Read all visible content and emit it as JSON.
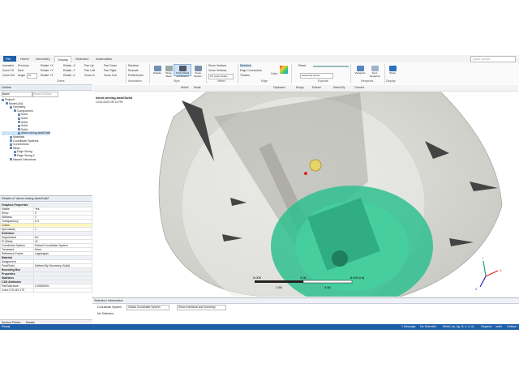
{
  "tabs": [
    "File",
    "Home",
    "Geometry",
    "Display",
    "Selection",
    "Automation"
  ],
  "active_tab": "Display",
  "search_placeholder": "Quick Launch",
  "ribbon": {
    "orient_items": [
      "Isometric",
      "Previous",
      "Rotate +X",
      "Rotate -X",
      "Pan Up",
      "Pan Down",
      "Random"
    ],
    "orient_items2": [
      "Zoom Fit",
      "Next",
      "Rotate +Y",
      "Rotate -Y",
      "Pan Left",
      "Pan Right",
      "Rescale"
    ],
    "orient_items3": [
      "Zoom Sel",
      "Angle",
      "Rotate +Z",
      "Rotate -Z",
      "Zoom In",
      "Zoom Out",
      "Preferences"
    ],
    "angle_value": "10",
    "group_orient": "Orient",
    "group_annotation": "Annotation",
    "style_buttons": [
      "Display",
      "Show Mesh",
      "Thick Shells and Beams",
      "Cross Section"
    ],
    "group_style": "Style",
    "vertex_items": [
      "Show Vertices",
      "Close Vertices",
      "Wireframe"
    ],
    "vertex_dd": "0.5 (Auto Scale)",
    "group_vertex": "Vertex",
    "edge_items": [
      "Direction",
      "Edge Connection",
      "Thicken"
    ],
    "group_edge": "Edge",
    "color_label": "Color",
    "explode_label": "Reset",
    "explode_dd": "Assembly Center",
    "group_explode": "Explode",
    "viewports_label": "Viewports",
    "sync_label": "Sync Viewports",
    "group_viewports": "Viewports",
    "display_label": "Show",
    "group_display": "Display"
  },
  "outline": {
    "title": "Outline",
    "name_label": "Name",
    "search_placeholder": "Search Outline",
    "items": [
      {
        "label": "Project*",
        "indent": 0
      },
      {
        "label": "Model (A4)",
        "indent": 1
      },
      {
        "label": "Geometry",
        "indent": 2
      },
      {
        "label": "Component1",
        "indent": 3
      },
      {
        "label": "Solid",
        "indent": 4
      },
      {
        "label": "Solid",
        "indent": 4
      },
      {
        "label": "Solid",
        "indent": 4
      },
      {
        "label": "Solid",
        "indent": 4
      },
      {
        "label": "Solid",
        "indent": 4
      },
      {
        "label": "diced-mixing-tank\\Solid",
        "indent": 4
      },
      {
        "label": "Materials",
        "indent": 2
      },
      {
        "label": "Coordinate Systems",
        "indent": 2
      },
      {
        "label": "Connections",
        "indent": 2
      },
      {
        "label": "Mesh",
        "indent": 2
      },
      {
        "label": "Edge Sizing",
        "indent": 3
      },
      {
        "label": "Edge Sizing 2",
        "indent": 3
      },
      {
        "label": "Named Selections",
        "indent": 2
      }
    ],
    "selected_index": 9
  },
  "details": {
    "title": "Details of \"diced-mixing-tank\\Solid\"",
    "rows": [
      {
        "k": "Graphics Properties",
        "v": "",
        "sec": true
      },
      {
        "k": "Visible",
        "v": "Yes"
      },
      {
        "k": "Show",
        "v": "0"
      },
      {
        "k": "Stiffness",
        "v": "1"
      },
      {
        "k": "Transparency",
        "v": "0.3"
      },
      {
        "k": "Colors",
        "v": "",
        "hl": true
      },
      {
        "k": "Specularity",
        "v": "1"
      },
      {
        "k": "Definition",
        "v": "",
        "sec": true
      },
      {
        "k": "Suppressed",
        "v": "No"
      },
      {
        "k": "ID (Beta)",
        "v": "41"
      },
      {
        "k": "Coordinate System",
        "v": "Default Coordinate System"
      },
      {
        "k": "Treatment",
        "v": "None"
      },
      {
        "k": "Reference Frame",
        "v": "Lagrangian"
      },
      {
        "k": "Material",
        "v": "",
        "sec": true
      },
      {
        "k": "Assignment",
        "v": ""
      },
      {
        "k": "Fluid/Solid",
        "v": "Defined By Geometry (Solid)"
      },
      {
        "k": "Bounding Box",
        "v": "",
        "sec": true
      },
      {
        "k": "Properties",
        "v": "",
        "sec": true
      },
      {
        "k": "Statistics",
        "v": "",
        "sec": true
      },
      {
        "k": "CAD Attributes",
        "v": "",
        "sec": true
      },
      {
        "k": "PartTolerance:",
        "v": "0.00000001"
      },
      {
        "k": "Color:175.143.175",
        "v": ""
      }
    ]
  },
  "viewport": {
    "toolbar": [
      "Select",
      "Mode",
      "Clipboard",
      "Empty",
      "Extend",
      "Select By",
      "Convert"
    ],
    "title": "diced-mixing-tank\\Solid",
    "date": "12/21/2020 05:14 PM",
    "scale_labels": [
      "0.000",
      "3.00",
      "6.000 (m)",
      "1.50",
      "4.50"
    ],
    "axis_labels": [
      "Y",
      "X",
      "Z"
    ]
  },
  "selinfo": {
    "title": "Selection Information",
    "cs_label": "Coordinate System",
    "cs_value": "Global Coordinate System",
    "show_value": "Show Individual and Summary",
    "status": "No Selection"
  },
  "bottom_tabs": [
    "Section Planes",
    "Details"
  ],
  "status": {
    "ready": "Ready",
    "messages": "1 Message",
    "selection": "No Selection",
    "units": "Metric (m, kg, N, s, V, A)",
    "angle": "Degrees",
    "rad": "rad/s",
    "temp": "Celsius"
  },
  "colors": {
    "accent": "#1f5fa8",
    "green": "#2fbf8f",
    "shell": "#d7d7d2"
  }
}
